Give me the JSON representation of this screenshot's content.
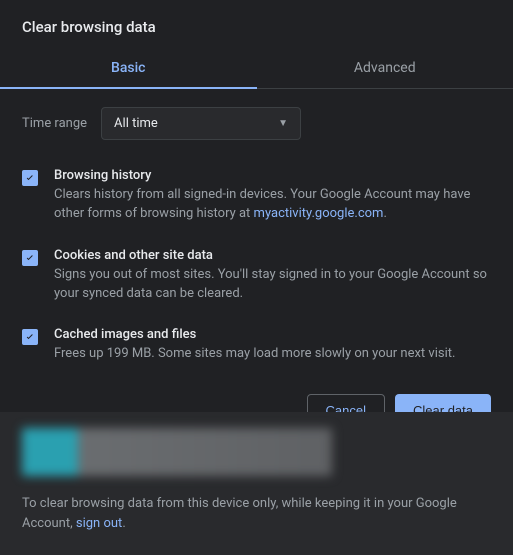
{
  "dialog": {
    "title": "Clear browsing data"
  },
  "tabs": {
    "basic": "Basic",
    "advanced": "Advanced"
  },
  "timerange": {
    "label": "Time range",
    "value": "All time"
  },
  "options": {
    "history": {
      "title": "Browsing history",
      "desc_before": "Clears history from all signed-in devices. Your Google Account may have other forms of browsing history at ",
      "link": "myactivity.google.com",
      "desc_after": "."
    },
    "cookies": {
      "title": "Cookies and other site data",
      "desc": "Signs you out of most sites. You'll stay signed in to your Google Account so your synced data can be cleared."
    },
    "cache": {
      "title": "Cached images and files",
      "desc": "Frees up 199 MB. Some sites may load more slowly on your next visit."
    }
  },
  "buttons": {
    "cancel": "Cancel",
    "clear": "Clear data"
  },
  "footer": {
    "text_before": "To clear browsing data from this device only, while keeping it in your Google Account, ",
    "link": "sign out",
    "text_after": "."
  }
}
